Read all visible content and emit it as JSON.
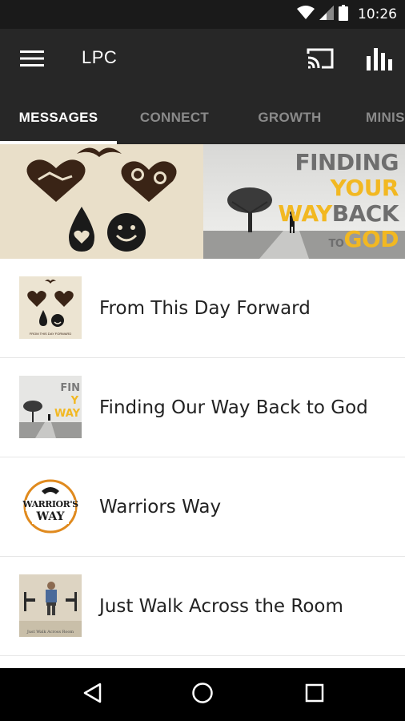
{
  "status_bar": {
    "time": "10:26",
    "icons": [
      "wifi-icon",
      "cell-signal-icon",
      "battery-icon"
    ]
  },
  "app_bar": {
    "title": "LPC",
    "icons": [
      "menu-icon",
      "cast-icon",
      "bar-chart-icon"
    ]
  },
  "tabs": [
    {
      "label": "MESSAGES",
      "active": true
    },
    {
      "label": "CONNECT",
      "active": false
    },
    {
      "label": "GROWTH",
      "active": false
    },
    {
      "label": "MINIS",
      "active": false
    }
  ],
  "banner": {
    "right_words": [
      "FINDING",
      "YOUR",
      "WAY",
      "BACK",
      "TO",
      "GOD"
    ]
  },
  "messages": [
    {
      "title": "From This Day Forward",
      "thumb_caption": "FROM THIS DAY FORWARD"
    },
    {
      "title": "Finding Our Way Back to God",
      "thumb_words": [
        "FIN",
        "Y",
        "WAY"
      ]
    },
    {
      "title": "Warriors Way",
      "thumb_words": [
        "WARRIOR'S",
        "WAY"
      ]
    },
    {
      "title": "Just Walk Across the Room",
      "thumb_caption": "Just Walk Across Room"
    }
  ],
  "nav_bar": {
    "icons": [
      "back-icon",
      "home-icon",
      "recents-icon"
    ]
  },
  "colors": {
    "app_bar": "#272727",
    "status_bar": "#1a1a1a",
    "accent_gold": "#f2b822",
    "tab_inactive": "#8a8a8a"
  }
}
